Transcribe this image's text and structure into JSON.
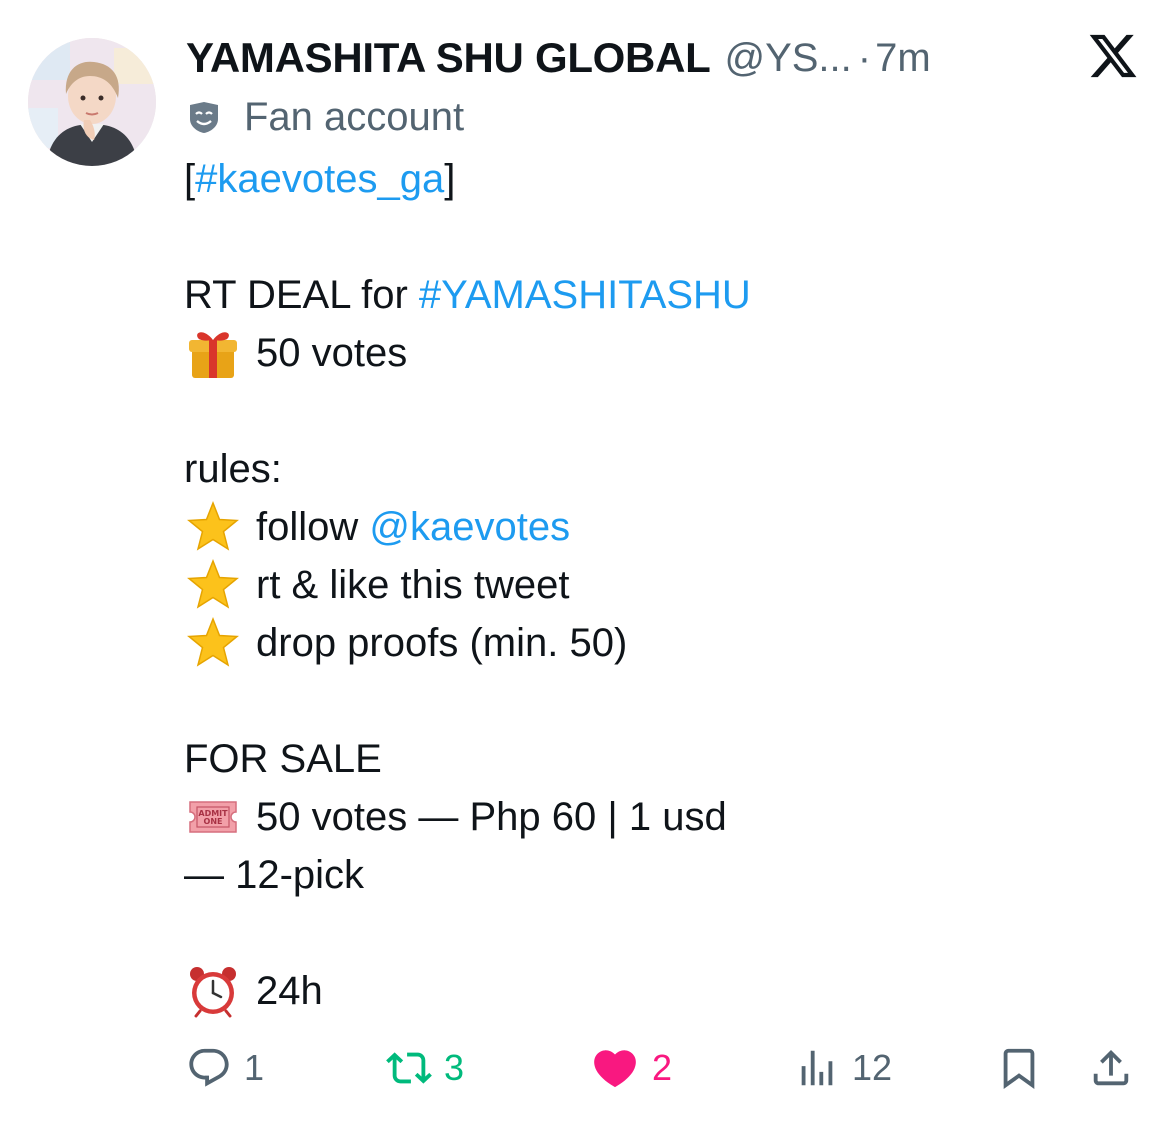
{
  "tweet": {
    "author_name": "YAMASHITA SHU GLOBAL",
    "handle": "@YS...",
    "separator": "·",
    "time": "7m",
    "label": "Fan account",
    "lines": {
      "l1_pre": "[",
      "l1_tag": "#kaevotes_ga",
      "l1_post": "]",
      "l2_text": "RT DEAL for ",
      "l2_tag": "#YAMASHITASHU",
      "l3_text": "50 votes",
      "l4_text": "rules:",
      "l5_text": "follow ",
      "l5_mention": "@kaevotes",
      "l6_text": "rt & like this tweet",
      "l7_text": "drop proofs (min. 50)",
      "l8_text": "FOR SALE",
      "l9_text": "50 votes — Php 60 | 1 usd",
      "l10_text": "— 12-pick",
      "l11_text": "24h"
    },
    "icons": {
      "gift": "wrapped-gift-emoji",
      "star": "star-emoji",
      "ticket": "admit-one-ticket-emoji",
      "ticket_text_1": "ADMIT",
      "ticket_text_2": "ONE",
      "clock": "alarm-clock-emoji",
      "mask": "performing-arts-mask-icon"
    }
  },
  "actions": {
    "reply_count": "1",
    "retweet_count": "3",
    "like_count": "2",
    "views_count": "12"
  },
  "colors": {
    "text": "#0f1419",
    "secondary": "#536471",
    "link": "#1d9bf0",
    "retweet_active": "#00ba7c",
    "like_active": "#f91880"
  }
}
